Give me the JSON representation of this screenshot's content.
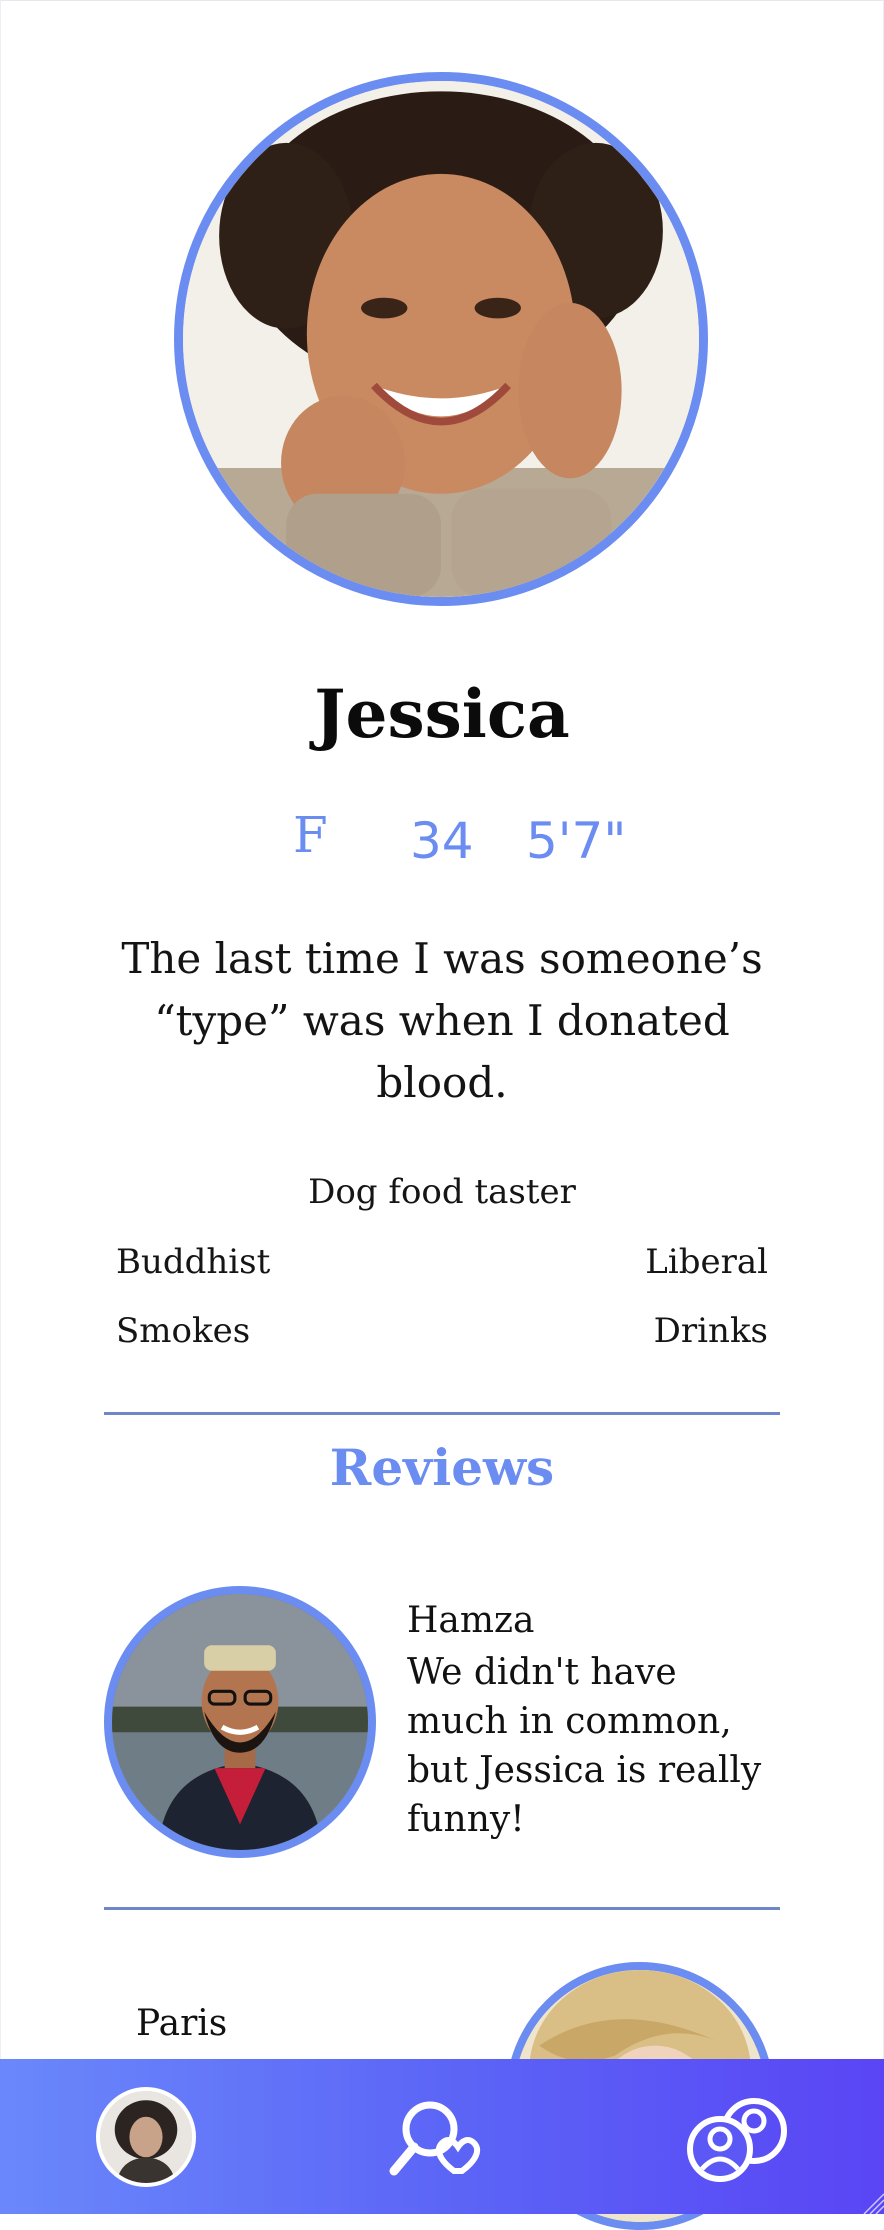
{
  "profile": {
    "name": "Jessica",
    "gender": "F",
    "age": "34",
    "height": "5'7\"",
    "bio": "The last time I was someone’s “type” was when I donated blood.",
    "occupation": "Dog food taster",
    "religion": "Buddhist",
    "politics": "Liberal",
    "smoking": "Smokes",
    "drinking": "Drinks"
  },
  "reviews": {
    "heading": "Reviews",
    "items": [
      {
        "author": "Hamza",
        "text": "We didn't have much in common, but Jessica is really funny!"
      },
      {
        "author": "Paris",
        "text": ""
      }
    ]
  },
  "nav": {
    "items": [
      {
        "icon": "profile-avatar"
      },
      {
        "icon": "search-heart-icon"
      },
      {
        "icon": "people-icon"
      }
    ]
  },
  "colors": {
    "accent": "#6b8cf0",
    "divider": "#6f86c8",
    "nav_gradient_start": "#6a88fb",
    "nav_gradient_end": "#5a45f5"
  }
}
